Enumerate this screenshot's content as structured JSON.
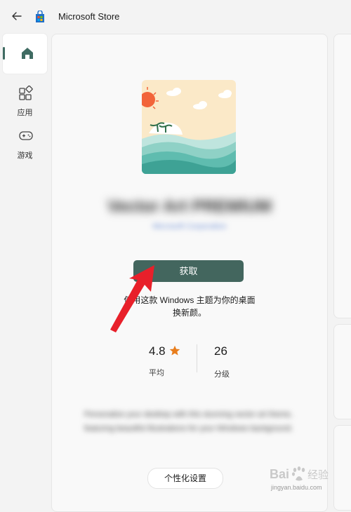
{
  "titlebar": {
    "title": "Microsoft Store"
  },
  "nav": {
    "items": [
      {
        "label": "应用",
        "icon": "apps-icon"
      },
      {
        "label": "游戏",
        "icon": "gamepad-icon"
      }
    ]
  },
  "product": {
    "name": "Vector Art PREMIUM",
    "publisher": "Microsoft Corporation",
    "get_button": "获取",
    "description_line1": "使用这款 Windows 主题为你的桌面",
    "description_line2": "换新颜。",
    "rating": {
      "value": "4.8",
      "label": "平均"
    },
    "ratings_count": {
      "value": "26",
      "label": "分级"
    },
    "about": "Personalize your desktop with this stunning vector art theme, featuring beautiful illustrations for your Windows background.",
    "settings_button": "个性化设置"
  },
  "colors": {
    "accent": "#43665e",
    "star": "#e87d1c",
    "arrow": "#e8202a"
  },
  "watermark": {
    "text": "Baidu经验",
    "url": "jingyan.baidu.com"
  }
}
